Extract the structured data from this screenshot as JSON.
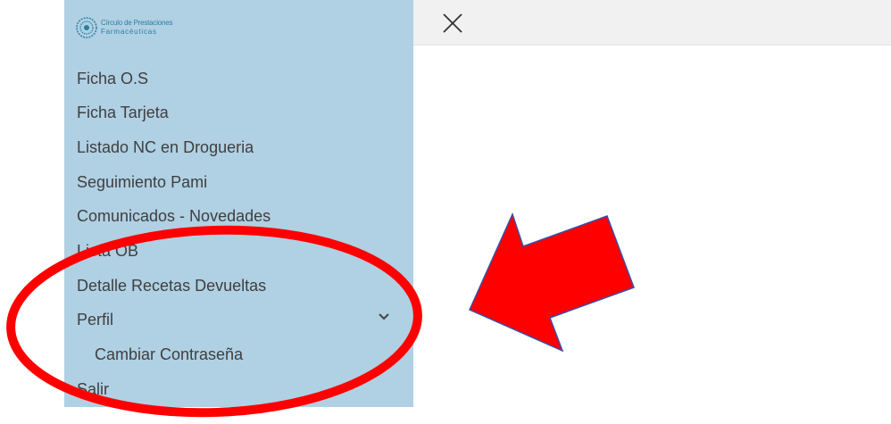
{
  "logo": {
    "line1": "Círculo de Prestaciones",
    "line2": "Farmacéuticas"
  },
  "menu": {
    "items": [
      "Ficha O.S",
      "Ficha Tarjeta",
      "Listado NC en Drogueria",
      "Seguimiento Pami",
      "Comunicados - Novedades",
      "Lista OB",
      "Detalle Recetas Devueltas",
      "Perfil"
    ],
    "sub_items": [
      "Cambiar Contraseña"
    ],
    "logout": "Salir"
  },
  "icons": {
    "close": "close-icon",
    "expand": "chevron-down-icon",
    "logo": "logo-icon"
  },
  "colors": {
    "sidebar_bg": "#b0d0e3",
    "menu_text": "#3f3f3f",
    "annotation_red": "#ff0000",
    "arrow_border": "#3b4fa8"
  }
}
